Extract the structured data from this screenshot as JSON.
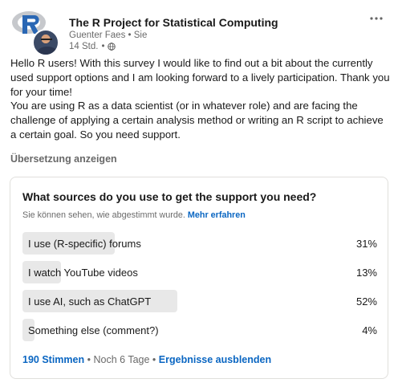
{
  "post": {
    "group_name": "The R Project for Statistical Computing",
    "author": "Guenter Faes",
    "author_relation": "Sie",
    "time": "14 Std.",
    "visibility_icon": "globe-icon",
    "menu_icon": "more-horizontal-icon",
    "paragraphs": [
      "Hello R users! With this survey I would like to find out a bit about the currently used support options and I am looking forward to a lively participation. Thank you for your time!",
      "You are using R as a data scientist (or in whatever role) and are facing the challenge of applying a certain analysis method or writing an R script to achieve a certain goal. So you need support."
    ],
    "translate_label": "Übersetzung anzeigen"
  },
  "poll": {
    "question": "What sources do you use to get the support you need?",
    "info_text": "Sie können sehen, wie abgestimmt wurde.",
    "info_link": "Mehr erfahren",
    "options": [
      {
        "label": "I use (R-specific) forums",
        "percent_label": "31%",
        "percent": 31
      },
      {
        "label": "I watch YouTube videos",
        "percent_label": "13%",
        "percent": 13
      },
      {
        "label": "I use AI, such as ChatGPT",
        "percent_label": "52%",
        "percent": 52
      },
      {
        "label": "Something else (comment?)",
        "percent_label": "4%",
        "percent": 4
      }
    ],
    "votes": "190 Stimmen",
    "remaining": "Noch 6 Tage",
    "hide_results": "Ergebnisse ausblenden",
    "bar_color": "#e8e8e8",
    "link_color": "#0a66c2"
  }
}
